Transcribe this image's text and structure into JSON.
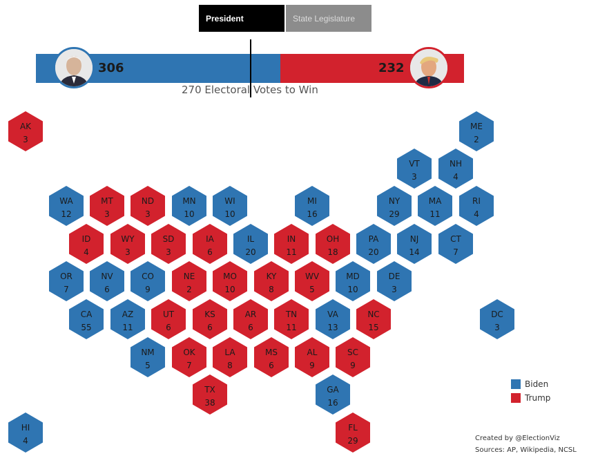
{
  "tabs": {
    "president": "President",
    "legislature": "State Legislature"
  },
  "totals": {
    "biden": "306",
    "trump": "232"
  },
  "threshold_label": "270 Electoral Votes to Win",
  "legend": [
    {
      "label": "Biden",
      "color": "#2f75b2"
    },
    {
      "label": "Trump",
      "color": "#d2222d"
    }
  ],
  "credits": {
    "line1": "Created by @ElectionViz",
    "line2": "Sources: AP, Wikipedia, NCSL"
  },
  "colors": {
    "biden": "#2f75b2",
    "trump": "#d2222d"
  },
  "chart_data": {
    "type": "hex-tile map",
    "totals": {
      "Biden": 306,
      "Trump": 232
    },
    "threshold": 270,
    "states": [
      {
        "abbr": "AK",
        "ev": "3",
        "winner": "Trump"
      },
      {
        "abbr": "ME",
        "ev": "2",
        "winner": "Biden"
      },
      {
        "abbr": "VT",
        "ev": "3",
        "winner": "Biden"
      },
      {
        "abbr": "NH",
        "ev": "4",
        "winner": "Biden"
      },
      {
        "abbr": "WA",
        "ev": "12",
        "winner": "Biden"
      },
      {
        "abbr": "MT",
        "ev": "3",
        "winner": "Trump"
      },
      {
        "abbr": "ND",
        "ev": "3",
        "winner": "Trump"
      },
      {
        "abbr": "MN",
        "ev": "10",
        "winner": "Biden"
      },
      {
        "abbr": "WI",
        "ev": "10",
        "winner": "Biden"
      },
      {
        "abbr": "MI",
        "ev": "16",
        "winner": "Biden"
      },
      {
        "abbr": "NY",
        "ev": "29",
        "winner": "Biden"
      },
      {
        "abbr": "MA",
        "ev": "11",
        "winner": "Biden"
      },
      {
        "abbr": "RI",
        "ev": "4",
        "winner": "Biden"
      },
      {
        "abbr": "ID",
        "ev": "4",
        "winner": "Trump"
      },
      {
        "abbr": "WY",
        "ev": "3",
        "winner": "Trump"
      },
      {
        "abbr": "SD",
        "ev": "3",
        "winner": "Trump"
      },
      {
        "abbr": "IA",
        "ev": "6",
        "winner": "Trump"
      },
      {
        "abbr": "IL",
        "ev": "20",
        "winner": "Biden"
      },
      {
        "abbr": "IN",
        "ev": "11",
        "winner": "Trump"
      },
      {
        "abbr": "OH",
        "ev": "18",
        "winner": "Trump"
      },
      {
        "abbr": "PA",
        "ev": "20",
        "winner": "Biden"
      },
      {
        "abbr": "NJ",
        "ev": "14",
        "winner": "Biden"
      },
      {
        "abbr": "CT",
        "ev": "7",
        "winner": "Biden"
      },
      {
        "abbr": "OR",
        "ev": "7",
        "winner": "Biden"
      },
      {
        "abbr": "NV",
        "ev": "6",
        "winner": "Biden"
      },
      {
        "abbr": "CO",
        "ev": "9",
        "winner": "Biden"
      },
      {
        "abbr": "NE",
        "ev": "2",
        "winner": "Trump"
      },
      {
        "abbr": "MO",
        "ev": "10",
        "winner": "Trump"
      },
      {
        "abbr": "KY",
        "ev": "8",
        "winner": "Trump"
      },
      {
        "abbr": "WV",
        "ev": "5",
        "winner": "Trump"
      },
      {
        "abbr": "MD",
        "ev": "10",
        "winner": "Biden"
      },
      {
        "abbr": "DE",
        "ev": "3",
        "winner": "Biden"
      },
      {
        "abbr": "CA",
        "ev": "55",
        "winner": "Biden"
      },
      {
        "abbr": "AZ",
        "ev": "11",
        "winner": "Biden"
      },
      {
        "abbr": "UT",
        "ev": "6",
        "winner": "Trump"
      },
      {
        "abbr": "KS",
        "ev": "6",
        "winner": "Trump"
      },
      {
        "abbr": "AR",
        "ev": "6",
        "winner": "Trump"
      },
      {
        "abbr": "TN",
        "ev": "11",
        "winner": "Trump"
      },
      {
        "abbr": "VA",
        "ev": "13",
        "winner": "Biden"
      },
      {
        "abbr": "NC",
        "ev": "15",
        "winner": "Trump"
      },
      {
        "abbr": "DC",
        "ev": "3",
        "winner": "Biden"
      },
      {
        "abbr": "NM",
        "ev": "5",
        "winner": "Biden"
      },
      {
        "abbr": "OK",
        "ev": "7",
        "winner": "Trump"
      },
      {
        "abbr": "LA",
        "ev": "8",
        "winner": "Trump"
      },
      {
        "abbr": "MS",
        "ev": "6",
        "winner": "Trump"
      },
      {
        "abbr": "AL",
        "ev": "9",
        "winner": "Trump"
      },
      {
        "abbr": "SC",
        "ev": "9",
        "winner": "Trump"
      },
      {
        "abbr": "TX",
        "ev": "38",
        "winner": "Trump"
      },
      {
        "abbr": "GA",
        "ev": "16",
        "winner": "Biden"
      },
      {
        "abbr": "HI",
        "ev": "4",
        "winner": "Biden"
      },
      {
        "abbr": "FL",
        "ev": "29",
        "winner": "Trump"
      }
    ]
  }
}
